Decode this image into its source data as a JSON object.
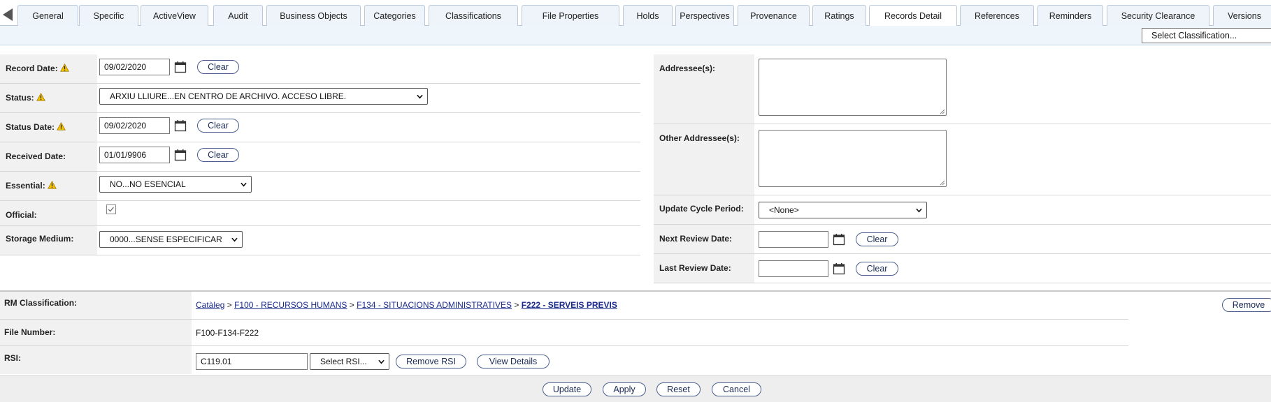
{
  "tabs": [
    {
      "label": "General",
      "active": false
    },
    {
      "label": "Specific",
      "active": false
    },
    {
      "label": "ActiveView",
      "active": false
    },
    {
      "label": "Audit",
      "active": false
    },
    {
      "label": "Business Objects",
      "active": false
    },
    {
      "label": "Categories",
      "active": false
    },
    {
      "label": "Classifications",
      "active": false
    },
    {
      "label": "File Properties",
      "active": false
    },
    {
      "label": "Holds",
      "active": false
    },
    {
      "label": "Perspectives",
      "active": false
    },
    {
      "label": "Provenance",
      "active": false
    },
    {
      "label": "Ratings",
      "active": false
    },
    {
      "label": "Records Detail",
      "active": true
    },
    {
      "label": "References",
      "active": false
    },
    {
      "label": "Reminders",
      "active": false
    },
    {
      "label": "Security Clearance",
      "active": false
    },
    {
      "label": "Versions",
      "active": false
    }
  ],
  "toolbar": {
    "select_classification": "Select Classification..."
  },
  "left": {
    "record_date": {
      "label": "Record Date:",
      "value": "09/02/2020",
      "clear": "Clear"
    },
    "status": {
      "label": "Status:",
      "value": "ARXIU LLIURE...EN CENTRO DE ARCHIVO. ACCESO LIBRE."
    },
    "status_date": {
      "label": "Status Date:",
      "value": "09/02/2020",
      "clear": "Clear"
    },
    "received_date": {
      "label": "Received Date:",
      "value": "01/01/9906",
      "clear": "Clear"
    },
    "essential": {
      "label": "Essential:",
      "value": "NO...NO ESENCIAL"
    },
    "official": {
      "label": "Official:",
      "checked": true
    },
    "storage_medium": {
      "label": "Storage Medium:",
      "value": "0000...SENSE ESPECIFICAR"
    }
  },
  "right": {
    "addressees": {
      "label": "Addressee(s):",
      "value": ""
    },
    "other_addressees": {
      "label": "Other Addressee(s):",
      "value": ""
    },
    "update_cycle": {
      "label": "Update Cycle Period:",
      "value": "<None>"
    },
    "next_review": {
      "label": "Next Review Date:",
      "value": "",
      "clear": "Clear"
    },
    "last_review": {
      "label": "Last Review Date:",
      "value": "",
      "clear": "Clear"
    }
  },
  "rm": {
    "classification_label": "RM Classification:",
    "breadcrumb": [
      "Catàleg",
      "F100 - RECURSOS HUMANS",
      "F134 - SITUACIONS ADMINISTRATIVES",
      "F222 - SERVEIS PREVIS"
    ],
    "separator": ">",
    "remove": "Remove",
    "file_number_label": "File Number:",
    "file_number": "F100-F134-F222",
    "rsi_label": "RSI:",
    "rsi_value": "C119.01",
    "select_rsi": "Select RSI...",
    "remove_rsi": "Remove RSI",
    "view_details": "View Details"
  },
  "footer": {
    "update": "Update",
    "apply": "Apply",
    "reset": "Reset",
    "cancel": "Cancel"
  },
  "colors": {
    "warning": "#f2c200",
    "link": "#1a2a8c",
    "tab_bg": "#eef4f9",
    "label_bg": "#f1f1f1"
  },
  "icons": {
    "warning": "warning-icon",
    "calendar": "calendar-icon",
    "chevron": "chevron-down-icon",
    "back": "arrow-left-icon",
    "check": "check-icon"
  }
}
